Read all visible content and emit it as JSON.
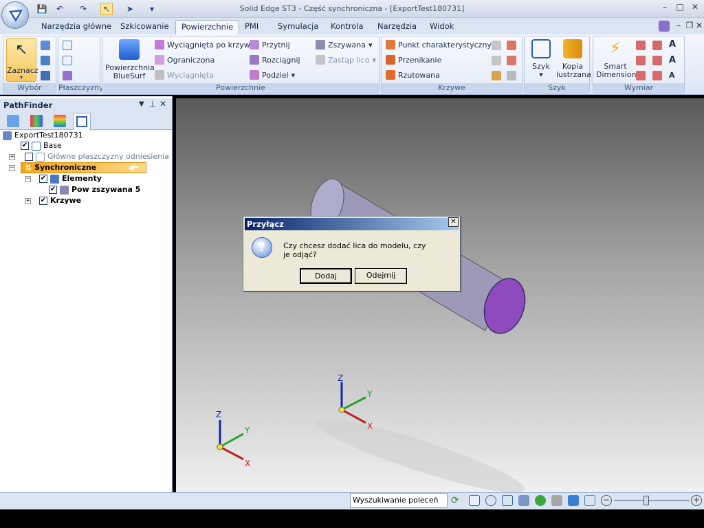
{
  "window": {
    "title": "Solid Edge ST3 - Część synchroniczna - [ExportTest180731]"
  },
  "tabs": [
    "Narzędzia główne",
    "Szkicowanie",
    "Powierzchnie",
    "PMI",
    "Symulacja",
    "Kontrola",
    "Narzędzia",
    "Widok"
  ],
  "ribbon": {
    "select": {
      "label": "Zaznacz",
      "group": "Wybór"
    },
    "planes": {
      "group": "Płaszczyzny"
    },
    "surfaces": {
      "group": "Powierzchnie",
      "bluesurf_line1": "Powierzchnia",
      "bluesurf_line2": "BlueSurf",
      "extruded_curve": "Wyciągnięta po krzywej",
      "bounded": "Ograniczona",
      "extruded": "Wyciągnięta",
      "trim": "Przytnij",
      "extend": "Rozciągnij",
      "split": "Podziel",
      "stitched": "Zszywana",
      "replace_face": "Zastąp lico"
    },
    "curves": {
      "group": "Krzywe",
      "keypoint": "Punkt charakterystyczny",
      "intersection": "Przenikanie",
      "projected": "Rzutowana"
    },
    "pattern": {
      "group": "Szyk",
      "pattern": "Szyk",
      "mirror_line1": "Kopia",
      "mirror_line2": "lustrzana"
    },
    "dimension": {
      "group": "Wymiar",
      "smart_line1": "Smart",
      "smart_line2": "Dimension"
    }
  },
  "pathfinder": {
    "title": "PathFinder",
    "tree": {
      "root": "ExportTest180731",
      "base": "Base",
      "ref_planes": "Główne płaszczyzny odniesienia",
      "sync": "Synchroniczne",
      "features": "Elementy",
      "stitched": "Pow zszywana 5",
      "curves": "Krzywe"
    }
  },
  "dialog": {
    "title": "Przyłącz",
    "message": "Czy chcesz dodać lica do modelu, czy je odjąć?",
    "add": "Dodaj",
    "subtract": "Odejmij"
  },
  "statusbar": {
    "search_placeholder": "Wyszukiwanie poleceń"
  },
  "axes": {
    "x": "X",
    "y": "Y",
    "z": "Z"
  }
}
